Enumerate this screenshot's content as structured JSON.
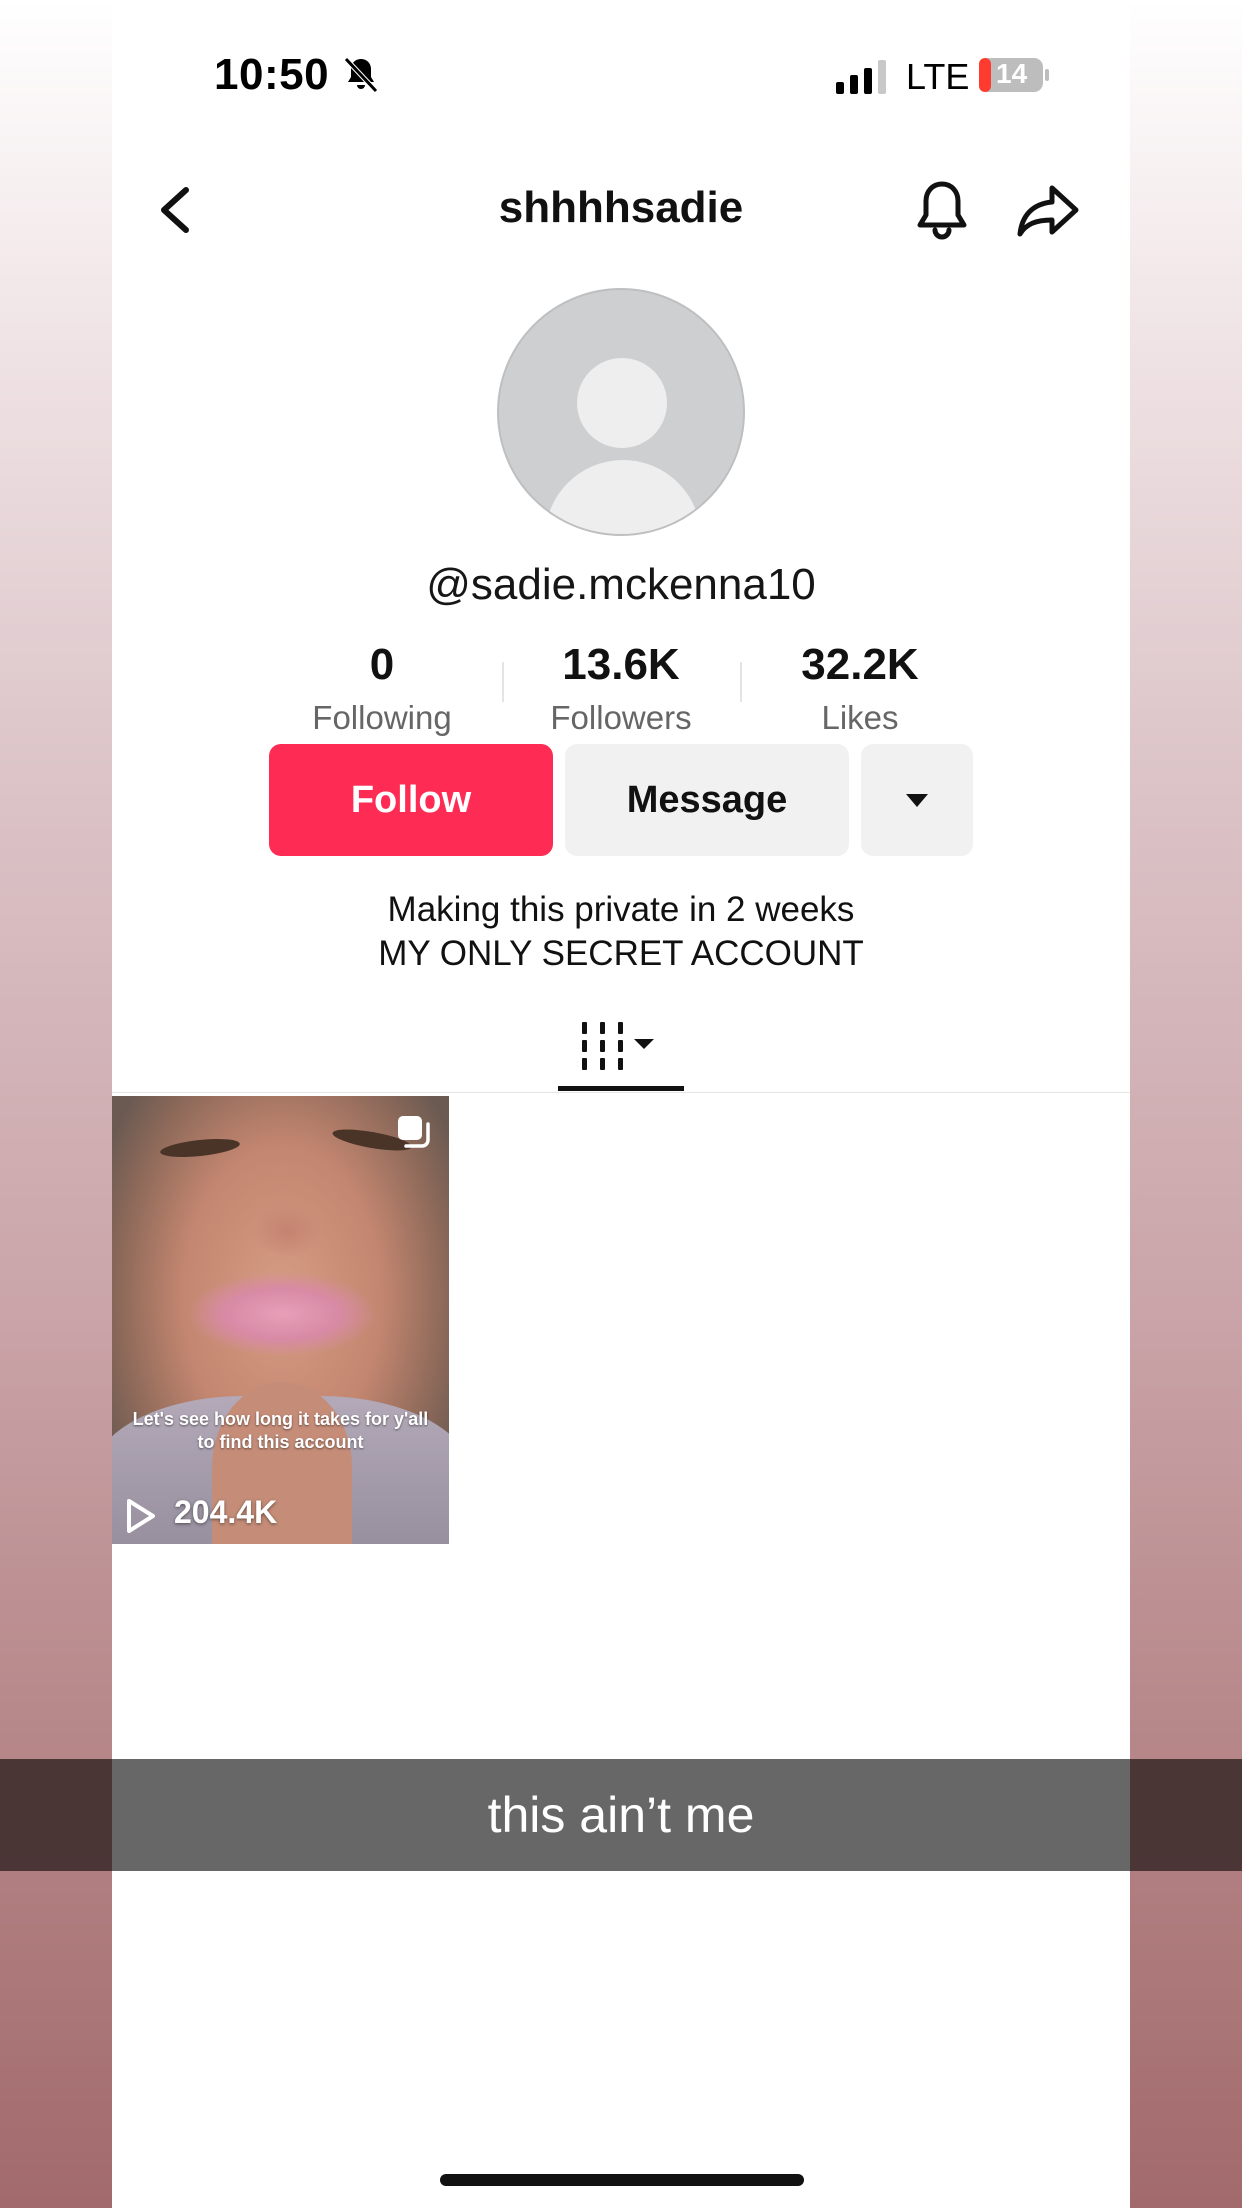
{
  "status_bar": {
    "time": "10:50",
    "network": "LTE",
    "battery": "14",
    "battery_color": "#ff3b30"
  },
  "header": {
    "title": "shhhhsadie",
    "back_icon": "chevron-left-icon",
    "notify_icon": "bell-icon",
    "share_icon": "share-arrow-icon"
  },
  "profile": {
    "handle": "@sadie.mckenna10",
    "stats": [
      {
        "value": "0",
        "label": "Following"
      },
      {
        "value": "13.6K",
        "label": "Followers"
      },
      {
        "value": "32.2K",
        "label": "Likes"
      }
    ],
    "follow_label": "Follow",
    "message_label": "Message",
    "bio_line1": "Making this private in 2 weeks",
    "bio_line2": "MY ONLY SECRET ACCOUNT",
    "accent_color": "#fe2c55"
  },
  "videos": [
    {
      "caption": "Let's see how long it takes for y'all to find this account",
      "views": "204.4K"
    }
  ],
  "overlay": {
    "caption": "this ain’t me"
  }
}
